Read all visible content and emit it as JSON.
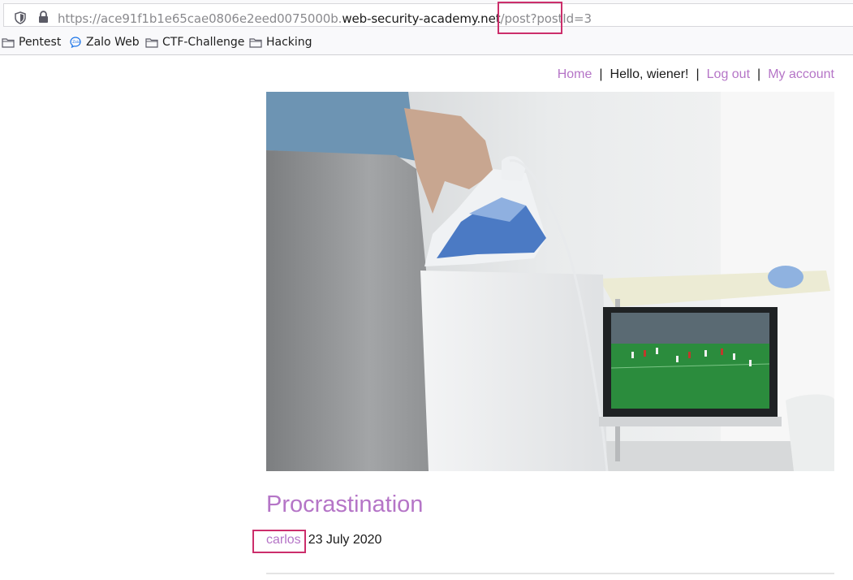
{
  "browser": {
    "url_prefix": "https://ace91f1b1e65cae0806e2eed0075000b.",
    "url_host": "web-security-academy.net",
    "url_path": "/post",
    "url_query": "?postId=3",
    "bookmarks": [
      {
        "label": "Pentest",
        "icon": "folder-icon"
      },
      {
        "label": "Zalo Web",
        "icon": "zalo-icon"
      },
      {
        "label": "CTF-Challenge",
        "icon": "folder-icon"
      },
      {
        "label": "Hacking",
        "icon": "folder-icon"
      }
    ]
  },
  "nav": {
    "home": "Home",
    "greeting": "Hello, wiener!",
    "logout": "Log out",
    "account": "My account",
    "separator": "|"
  },
  "post": {
    "title": "Procrastination",
    "author": "carlos",
    "date": "23 July 2020"
  },
  "colors": {
    "link": "#b575c7",
    "highlight": "#cc2e6b"
  }
}
